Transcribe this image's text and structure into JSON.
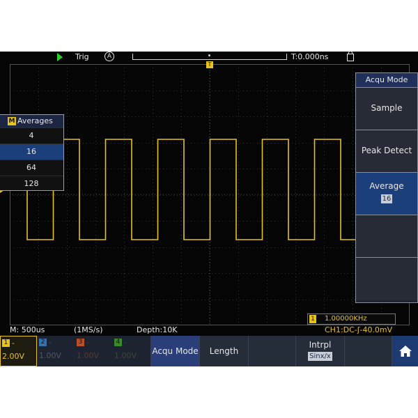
{
  "top_bar": {
    "trig_label": "Trig",
    "trig_mode": "A",
    "time_offset": "T:0.000ns"
  },
  "trigger_marker": "T",
  "averages_popup": {
    "badge": "M",
    "title": "Averages",
    "options": [
      "4",
      "16",
      "64",
      "128"
    ],
    "selected_index": 1
  },
  "side_menu": {
    "title": "Acqu Mode",
    "items": [
      {
        "label": "Sample"
      },
      {
        "label": "Peak Detect"
      },
      {
        "label": "Average",
        "value": "16"
      },
      {
        "label": ""
      },
      {
        "label": ""
      }
    ],
    "active_index": 2
  },
  "frequency": {
    "channel": "1",
    "value": "1.00000KHz"
  },
  "status": {
    "timebase": "M: 500us",
    "sample_rate": "(1MS/s)",
    "depth": "Depth:10K",
    "trigger_source": "CH1:DC-ʃ-40.0mV"
  },
  "channels": [
    {
      "num": "1",
      "dash": "-",
      "scale": "2.00V",
      "color": "#e8c21c",
      "active": true
    },
    {
      "num": "2",
      "dash": "-",
      "scale": "1.00V",
      "color": "#3a6fa8",
      "active": false
    },
    {
      "num": "3",
      "dash": "-",
      "scale": "1.00V",
      "color": "#b8502a",
      "active": false
    },
    {
      "num": "4",
      "dash": "-",
      "scale": "1.00V",
      "color": "#3a8a2a",
      "active": false
    }
  ],
  "softkeys": {
    "acqu_mode": "Acqu Mode",
    "length": "Length",
    "blank1": "",
    "intrpl_label": "Intrpl",
    "intrpl_value": "Sinx/x",
    "blank2": ""
  },
  "colors": {
    "trace": "#e8c21c",
    "run": "#2bd12b",
    "highlight": "#1b3f7a"
  }
}
